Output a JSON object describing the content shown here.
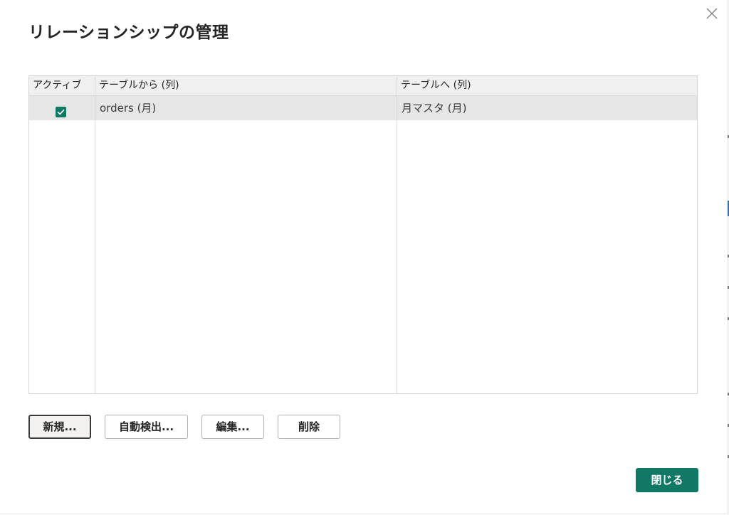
{
  "dialog": {
    "title": "リレーションシップの管理"
  },
  "table": {
    "headers": {
      "active": "アクティブ",
      "from": "テーブルから (列)",
      "to": "テーブルへ (列)"
    },
    "rows": [
      {
        "active": true,
        "from": "orders (月)",
        "to": "月マスタ (月)"
      }
    ]
  },
  "buttons": {
    "new": "新規...",
    "autodetect": "自動検出...",
    "edit": "編集...",
    "delete": "削除",
    "close": "閉じる"
  },
  "colors": {
    "accent": "#117865",
    "header_bg": "#f0f0f0",
    "selected_row_bg": "#e6e6e6"
  },
  "icons": {
    "close": "close-icon",
    "checkbox": "checkmark-icon"
  }
}
